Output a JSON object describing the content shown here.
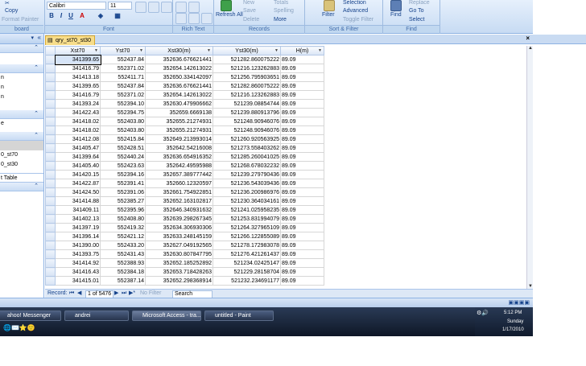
{
  "ribbon": {
    "clipboard": {
      "copy": "Copy",
      "format_painter": "Format Painter",
      "label": "board"
    },
    "font": {
      "name": "Calibri",
      "size": "11",
      "label": "Font",
      "bold": "B",
      "italic": "I",
      "underline": "U"
    },
    "rich_text": {
      "label": "Rich Text"
    },
    "records": {
      "refresh": "Refresh All",
      "save": "Save",
      "delete": "Delete",
      "spelling": "Spelling",
      "more": "More",
      "new": "New",
      "totals": "Totals",
      "label": "Records"
    },
    "sort_filter": {
      "filter": "Filter",
      "selection": "Selection",
      "advanced": "Advanced",
      "toggle_filter": "Toggle Filter",
      "label": "Sort & Filter"
    },
    "find": {
      "find": "Find",
      "replace": "Replace",
      "goto": "Go To",
      "select": "Select",
      "label": "Find"
    }
  },
  "nav": {
    "items": [
      {
        "label": "n",
        "selected": false
      },
      {
        "label": "n",
        "selected": false
      },
      {
        "label": "n",
        "selected": false
      },
      {
        "label": "e",
        "selected": false
      },
      {
        "label": "",
        "selected": true
      },
      {
        "label": "0_st70",
        "selected": false
      },
      {
        "label": "0_st30",
        "selected": false
      },
      {
        "label": "t Table",
        "selected": false
      }
    ]
  },
  "tab": {
    "title": "qry_st70_st30"
  },
  "table": {
    "columns": [
      "Xst70",
      "Yst70",
      "Xst30(m)",
      "Yst30(m)",
      "H(m)"
    ],
    "rows": [
      [
        "341399.65",
        "552437.84",
        "352636.676621441",
        "521282.860075222",
        "89.09"
      ],
      [
        "341416.79",
        "552371.02",
        "352654.142613022",
        "521216.123262883",
        "89.09"
      ],
      [
        "341413.18",
        "552411.71",
        "352650.334142097",
        "521256.795903651",
        "89.09"
      ],
      [
        "341399.65",
        "552437.84",
        "352636.676621441",
        "521282.860075222",
        "89.09"
      ],
      [
        "341416.79",
        "552371.02",
        "352654.142613022",
        "521216.123262883",
        "89.09"
      ],
      [
        "341393.24",
        "552394.10",
        "352630.479906662",
        "521239.08854744",
        "89.09"
      ],
      [
        "341422.43",
        "552394.75",
        "352659.6669138",
        "521239.880913796",
        "89.09"
      ],
      [
        "341418.02",
        "552403.80",
        "352655.21274931",
        "521248.90946076",
        "89.09"
      ],
      [
        "341418.02",
        "552403.80",
        "352655.21274931",
        "521248.90946076",
        "89.09"
      ],
      [
        "341412.08",
        "552415.84",
        "352649.213993014",
        "521260.920563925",
        "89.09"
      ],
      [
        "341405.47",
        "552428.51",
        "352642.54216008",
        "521273.558403262",
        "89.09"
      ],
      [
        "341399.64",
        "552440.24",
        "352636.654916352",
        "521285.260041025",
        "89.09"
      ],
      [
        "341405.40",
        "552423.63",
        "352642.49595988",
        "521268.678032232",
        "89.09"
      ],
      [
        "341420.15",
        "552394.16",
        "352657.389777442",
        "521239.279790436",
        "89.09"
      ],
      [
        "341422.87",
        "552391.41",
        "352660.12320597",
        "521236.543039436",
        "89.09"
      ],
      [
        "341424.50",
        "552391.06",
        "352661.754922851",
        "521236.200986976",
        "89.09"
      ],
      [
        "341414.88",
        "552385.27",
        "352652.163102817",
        "521230.364034161",
        "89.09"
      ],
      [
        "341409.11",
        "552395.96",
        "352646.340931632",
        "521241.025958235",
        "89.09"
      ],
      [
        "341402.13",
        "552408.80",
        "352639.298267345",
        "521253.831994079",
        "89.09"
      ],
      [
        "341397.19",
        "552419.32",
        "352634.306930306",
        "521264.327965109",
        "89.09"
      ],
      [
        "341396.14",
        "552421.12",
        "352633.248145159",
        "521266.122855089",
        "89.09"
      ],
      [
        "341390.00",
        "552433.20",
        "352627.049192565",
        "521278.172983078",
        "89.09"
      ],
      [
        "341393.75",
        "552431.43",
        "352630.807847795",
        "521276.421261437",
        "89.09"
      ],
      [
        "341414.92",
        "552388.93",
        "352652.185252892",
        "521234.02425147",
        "89.09"
      ],
      [
        "341416.43",
        "552384.18",
        "352653.718428263",
        "521229.28158704",
        "89.09"
      ],
      [
        "341415.01",
        "552387.14",
        "352652.298368914",
        "521232.234691177",
        "89.09"
      ]
    ]
  },
  "recnav": {
    "label": "Record:",
    "position": "1 of 5476",
    "no_filter": "No Filter",
    "search": "Search"
  },
  "taskbar": {
    "tasks": [
      {
        "label": "ahoo! Messenger",
        "active": false
      },
      {
        "label": "andrei",
        "active": false
      },
      {
        "label": "Microsoft Access - tra...",
        "active": true
      },
      {
        "label": "untitled - Paint",
        "active": false
      }
    ],
    "clock": {
      "time": "5:12 PM",
      "day": "Sunday",
      "date": "1/17/2010"
    }
  },
  "colors": {
    "ribbon": "#c7dbf3",
    "tab": "#f7dd8a",
    "taskbar": "#1c2a42"
  }
}
